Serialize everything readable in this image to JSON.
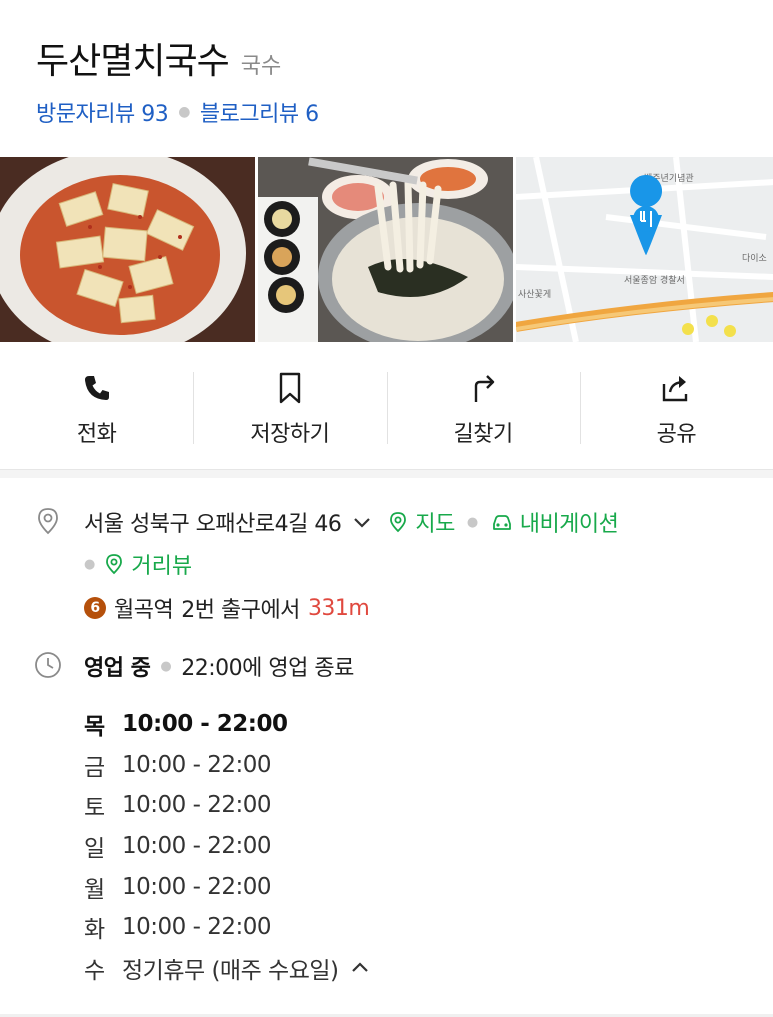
{
  "place": {
    "name": "두산멸치국수",
    "category": "국수",
    "visitor_reviews": "방문자리뷰 93",
    "blog_reviews": "블로그리뷰 6"
  },
  "photos": {
    "map_labels": [
      "백주년기념관",
      "다이소",
      "서울종암 경찰서",
      "사산꽃게"
    ]
  },
  "actions": [
    {
      "label": "전화",
      "icon": "phone-icon"
    },
    {
      "label": "저장하기",
      "icon": "bookmark-icon"
    },
    {
      "label": "길찾기",
      "icon": "directions-icon"
    },
    {
      "label": "공유",
      "icon": "share-icon"
    }
  ],
  "address": {
    "text": "서울 성북구 오패산로4길 46",
    "map_link": "지도",
    "navigation_link": "내비게이션",
    "street_view_link": "거리뷰"
  },
  "subway": {
    "line_number": "6",
    "station": "월곡역",
    "exit": "2번 출구에서",
    "distance": "331m",
    "line_color": "#b5500b"
  },
  "hours": {
    "status": "영업 중",
    "closing": "22:00에 영업 종료",
    "days": [
      {
        "day": "목",
        "time": "10:00 - 22:00",
        "today": true
      },
      {
        "day": "금",
        "time": "10:00 - 22:00"
      },
      {
        "day": "토",
        "time": "10:00 - 22:00"
      },
      {
        "day": "일",
        "time": "10:00 - 22:00"
      },
      {
        "day": "월",
        "time": "10:00 - 22:00"
      },
      {
        "day": "화",
        "time": "10:00 - 22:00"
      },
      {
        "day": "수",
        "time": "정기휴무 (매주 수요일)"
      }
    ]
  },
  "colors": {
    "link_blue": "#1f5fc4",
    "green": "#18a94b",
    "distance_red": "#e0493f"
  }
}
